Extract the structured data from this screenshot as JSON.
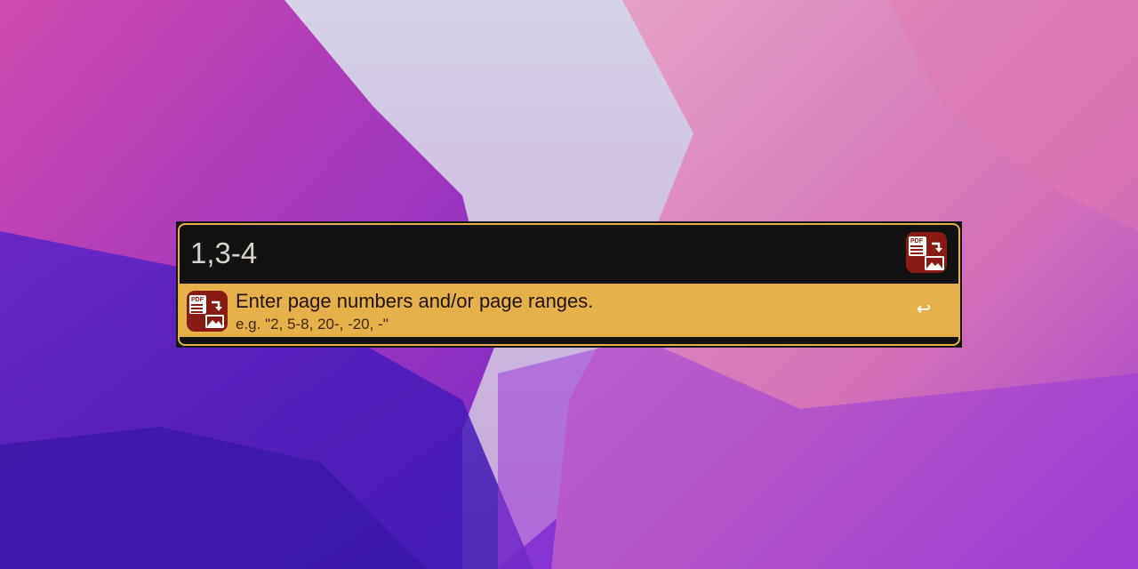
{
  "launcher": {
    "query_value": "1,3-4",
    "app_icon": "pdf-to-image-icon",
    "accent_color": "#e6b04a",
    "result": {
      "title": "Enter page numbers and/or page ranges.",
      "subtitle": "e.g. \"2, 5-8, 20-, -20, -\"",
      "icon": "pdf-to-image-icon",
      "action_icon": "return-icon",
      "action_glyph": "↩"
    }
  }
}
